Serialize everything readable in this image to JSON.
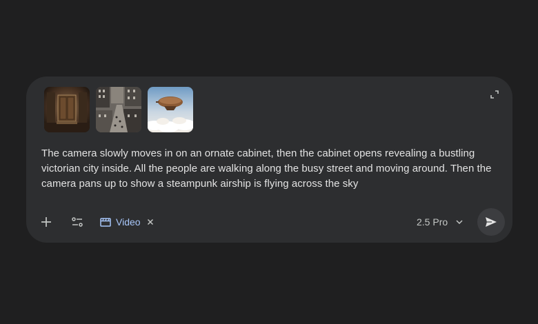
{
  "composer": {
    "attachments": [
      {
        "icon": "ornate-cabinet-image"
      },
      {
        "icon": "victorian-city-image"
      },
      {
        "icon": "steampunk-airship-image"
      }
    ],
    "prompt_text": "The camera slowly moves in on an ornate cabinet, then the cabinet opens revealing a bustling victorian city inside. All the people are walking along the busy street and moving around. Then the camera pans up to show a steampunk airship is flying across the sky",
    "toolbar": {
      "add_icon": "plus-icon",
      "tools_icon": "tune-icon",
      "mode_chip": {
        "label": "Video",
        "icon": "clapperboard-icon",
        "color": "#a8c7fa"
      },
      "model_label": "2.5 Pro",
      "send_icon": "send-icon"
    }
  },
  "colors": {
    "background": "#1f1f20",
    "composer_bg": "#2d2e30",
    "text": "#e3e3e3",
    "accent": "#a8c7fa"
  }
}
